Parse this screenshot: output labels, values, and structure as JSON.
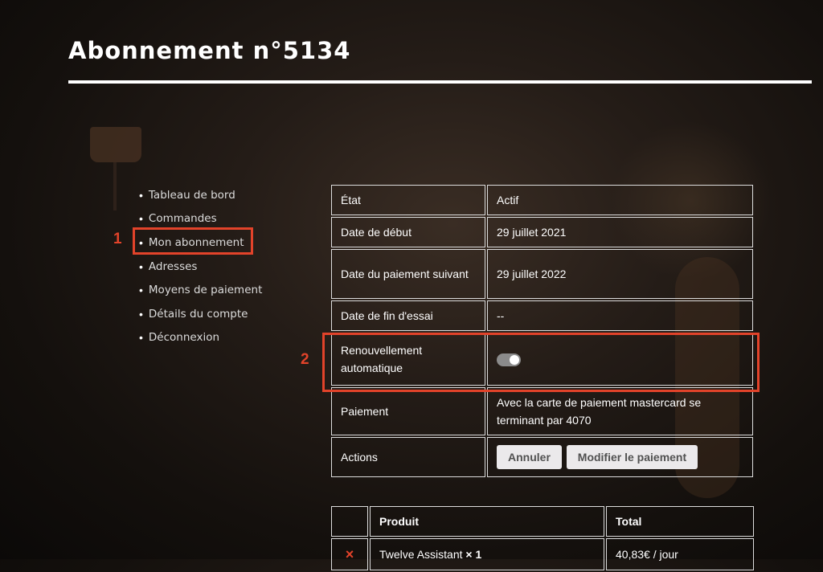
{
  "page": {
    "title": "Abonnement n°5134"
  },
  "nav": {
    "items": [
      {
        "label": "Tableau de bord"
      },
      {
        "label": "Commandes"
      },
      {
        "label": "Mon abonnement"
      },
      {
        "label": "Adresses"
      },
      {
        "label": "Moyens de paiement"
      },
      {
        "label": "Détails du compte"
      },
      {
        "label": "Déconnexion"
      }
    ]
  },
  "annotations": {
    "one": "1",
    "two": "2",
    "color": "#e2432a"
  },
  "details": {
    "state": {
      "label": "État",
      "value": "Actif"
    },
    "start": {
      "label": "Date de début",
      "value": "29 juillet 2021"
    },
    "next_payment": {
      "label": "Date du paiement suivant",
      "value": "29 juillet 2022"
    },
    "trial_end": {
      "label": "Date de fin d'essai",
      "value": "--"
    },
    "auto_renew": {
      "label": "Renouvellement automatique"
    },
    "payment": {
      "label": "Paiement",
      "value": "Avec la carte de paiement mastercard se terminant par 4070"
    },
    "actions": {
      "label": "Actions",
      "cancel": "Annuler",
      "modify": "Modifier le paiement"
    }
  },
  "products": {
    "headers": {
      "product": "Produit",
      "total": "Total"
    },
    "rows": [
      {
        "remove": "×",
        "name": "Twelve Assistant",
        "qty": "× 1",
        "total": "40,83€ / jour"
      }
    ]
  }
}
